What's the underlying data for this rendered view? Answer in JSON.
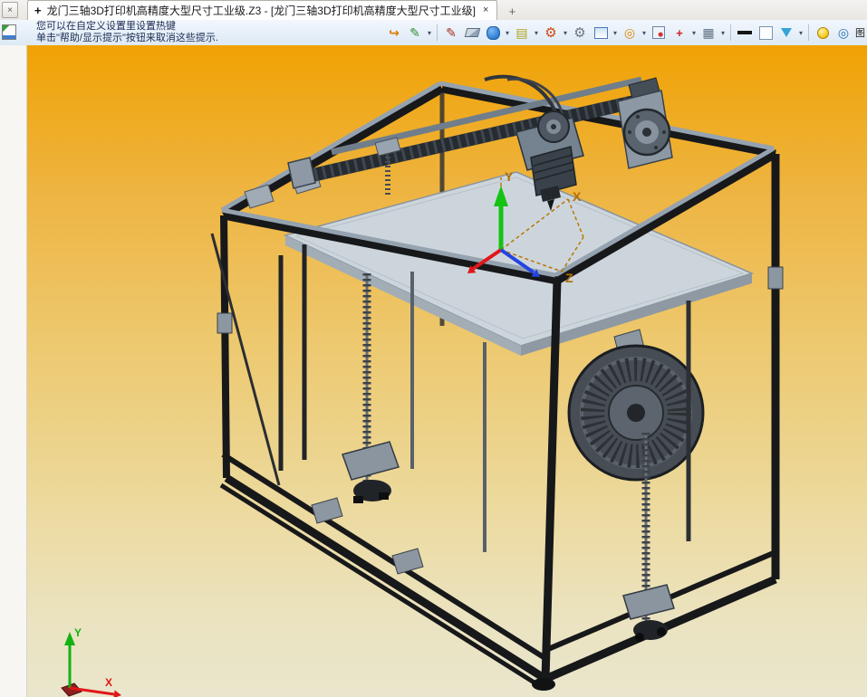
{
  "tabbar": {
    "corner_icon_glyph": "×",
    "tab": {
      "pin_glyph": "+",
      "title": "龙门三轴3D打印机高精度大型尺寸工业级.Z3 - [龙门三轴3D打印机高精度大型尺寸工业级]",
      "close_glyph": "×"
    },
    "new_tab_glyph": "+"
  },
  "toolbar": {
    "hint_line1": "您可以在自定义设置里设置热键",
    "hint_line2": "单击\"帮助/显示提示\"按钮来取消这些提示.",
    "dropdown_glyph": "▾",
    "layer_label": "图",
    "icons": [
      {
        "name": "exit-door-icon",
        "glyph": "↪"
      },
      {
        "name": "pencil-color-icon",
        "glyph": "✎"
      },
      {
        "name": "pen-icon",
        "glyph": "✎"
      },
      {
        "name": "eraser-icon",
        "glyph": ""
      },
      {
        "name": "material-cylinder-icon",
        "glyph": ""
      },
      {
        "name": "layer-stack-icon",
        "glyph": "▤"
      },
      {
        "name": "gear-settings-icon",
        "glyph": "⚙"
      },
      {
        "name": "gear-tools-icon",
        "glyph": "⚙"
      },
      {
        "name": "image-frame-icon",
        "glyph": ""
      },
      {
        "name": "compass-target-icon",
        "glyph": "◎"
      },
      {
        "name": "frame-point-icon",
        "glyph": ""
      },
      {
        "name": "annotation-cross-icon",
        "glyph": "+"
      },
      {
        "name": "display-monitor-icon",
        "glyph": "▦"
      },
      {
        "name": "line-width-icon",
        "glyph": ""
      },
      {
        "name": "background-color-icon",
        "glyph": ""
      },
      {
        "name": "section-wedge-icon",
        "glyph": ""
      },
      {
        "name": "light-bulb-icon",
        "glyph": ""
      },
      {
        "name": "render-mode-icon",
        "glyph": "◎"
      }
    ]
  },
  "viewport": {
    "triad": {
      "x": "X",
      "y": "Y",
      "z": "Z"
    },
    "nav_axes": {
      "x": "X",
      "y": "Y"
    }
  },
  "colors": {
    "viewport_top": "#f0a204",
    "viewport_bottom": "#eae6cd",
    "model_steel": "#8b9aa9",
    "bed_gray": "#cdd5dc",
    "frame_black": "#17181a",
    "axis_label_orange": "#b06f00"
  }
}
